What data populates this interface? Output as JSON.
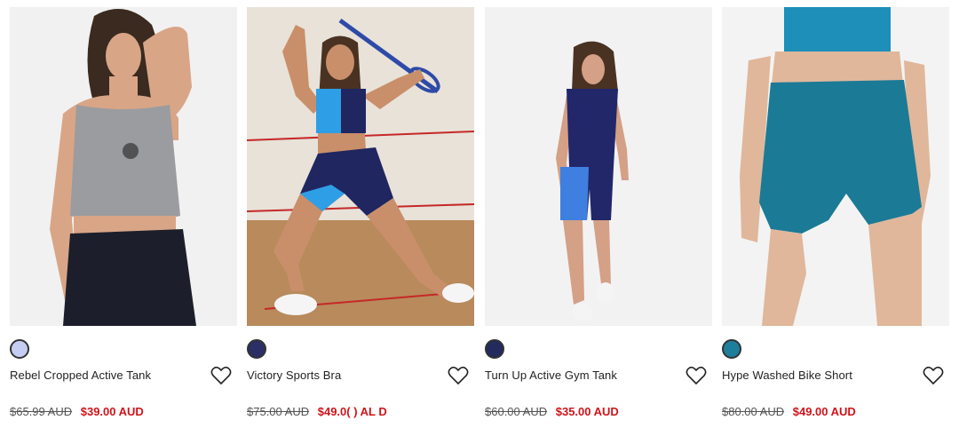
{
  "products": [
    {
      "name": "Rebel Cropped Active Tank",
      "swatch_color": "#c5cdf2",
      "price_was": "$65.99 AUD",
      "price_now": "$39.00 AUD",
      "image_alt": "model wearing grey cropped tank and black leggings"
    },
    {
      "name": "Victory Sports Bra",
      "swatch_color": "#2b2f66",
      "price_was": "$75.00 AUD",
      "price_now": "$49.0( ) AL D",
      "image_alt": "model in navy and blue sports bra and bike shorts with racquet"
    },
    {
      "name": "Turn Up Active Gym Tank",
      "swatch_color": "#232a5e",
      "price_was": "$60.00 AUD",
      "price_now": "$35.00 AUD",
      "image_alt": "model in navy tank and blue bike shorts"
    },
    {
      "name": "Hype Washed Bike Short",
      "swatch_color": "#1f7f9a",
      "price_was": "$80.00 AUD",
      "price_now": "$49.00 AUD",
      "image_alt": "model in teal bike shorts and crop top"
    }
  ],
  "icons": {
    "wishlist": "heart-outline-icon"
  },
  "colors": {
    "sale_price": "#d0131a"
  }
}
